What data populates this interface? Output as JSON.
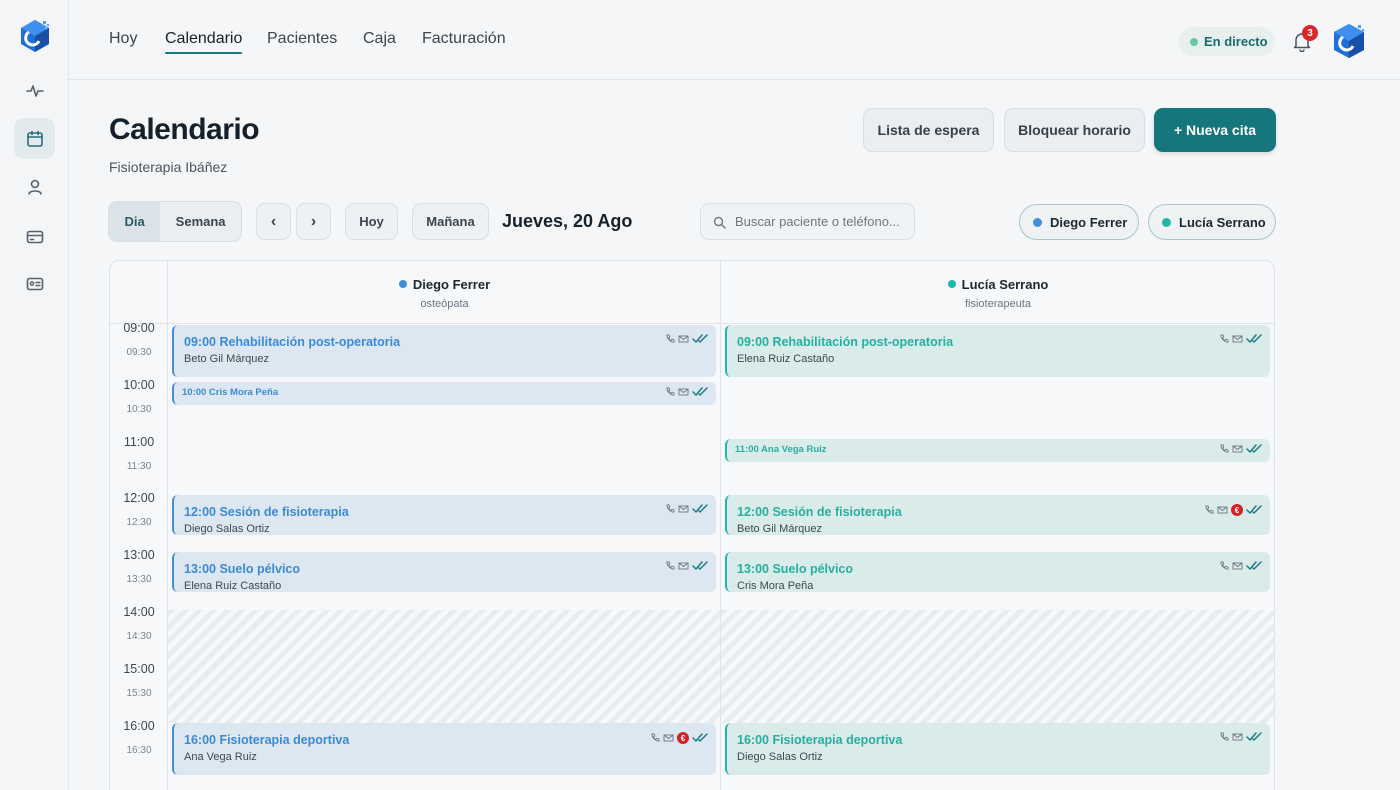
{
  "topnav": {
    "links": [
      "Hoy",
      "Calendario",
      "Pacientes",
      "Caja",
      "Facturación"
    ],
    "active": "Calendario",
    "live_label": "En directo",
    "notification_count": "3"
  },
  "sidebar": {
    "items": [
      "activity-icon",
      "calendar-icon",
      "user-icon",
      "card-icon",
      "id-card-icon"
    ],
    "active": "calendar-icon"
  },
  "header": {
    "title": "Calendario",
    "subtitle": "Fisioterapia Ibáñez",
    "waitlist_label": "Lista de espera",
    "block_label": "Bloquear horario",
    "new_label": "+ Nueva cita"
  },
  "toolbar": {
    "view_day": "Dia",
    "view_week": "Semana",
    "prev": "‹",
    "next": "›",
    "today": "Hoy",
    "tomorrow": "Mañana",
    "date": "Jueves, 20 Ago",
    "search_placeholder": "Buscar paciente o teléfono...",
    "filters": [
      {
        "name": "Diego Ferrer",
        "color": "#3f8fdc"
      },
      {
        "name": "Lucía Serrano",
        "color": "#20b7a8"
      }
    ]
  },
  "calendar": {
    "hours": [
      "09:00",
      "10:00",
      "11:00",
      "12:00",
      "13:00",
      "14:00",
      "15:00",
      "16:00"
    ],
    "halves": [
      "09:30",
      "10:30",
      "11:30",
      "12:30",
      "13:30",
      "14:30",
      "15:30",
      "16:30"
    ],
    "columns": [
      {
        "name": "Diego Ferrer",
        "role": "osteópata",
        "color": "#3f8fdc",
        "appointments": [
          {
            "title": "09:00 Rehabilitación post-operatoria",
            "patient": "Beto Gil Márquez"
          },
          {
            "title": "10:00 Cris Mora Peña",
            "patient": ""
          },
          {
            "title": "12:00 Sesión de fisioterapia",
            "patient": "Diego Salas Ortiz"
          },
          {
            "title": "13:00 Suelo pélvico",
            "patient": "Elena Ruiz Castaño"
          },
          {
            "title": "16:00 Fisioterapia deportiva",
            "patient": "Ana Vega Ruiz",
            "unpaid": "€"
          }
        ]
      },
      {
        "name": "Lucía Serrano",
        "role": "fisioterapeuta",
        "color": "#20b7a8",
        "appointments": [
          {
            "title": "09:00 Rehabilitación post-operatoria",
            "patient": "Elena Ruiz Castaño"
          },
          {
            "title": "11:00 Ana Vega Ruiz",
            "patient": ""
          },
          {
            "title": "12:00 Sesión de fisioterapia",
            "patient": "Beto Gil Márquez",
            "unpaid": "€"
          },
          {
            "title": "13:00 Suelo pélvico",
            "patient": "Cris Mora Peña"
          },
          {
            "title": "16:00 Fisioterapia deportiva",
            "patient": "Diego Salas Ortiz"
          }
        ]
      }
    ]
  }
}
